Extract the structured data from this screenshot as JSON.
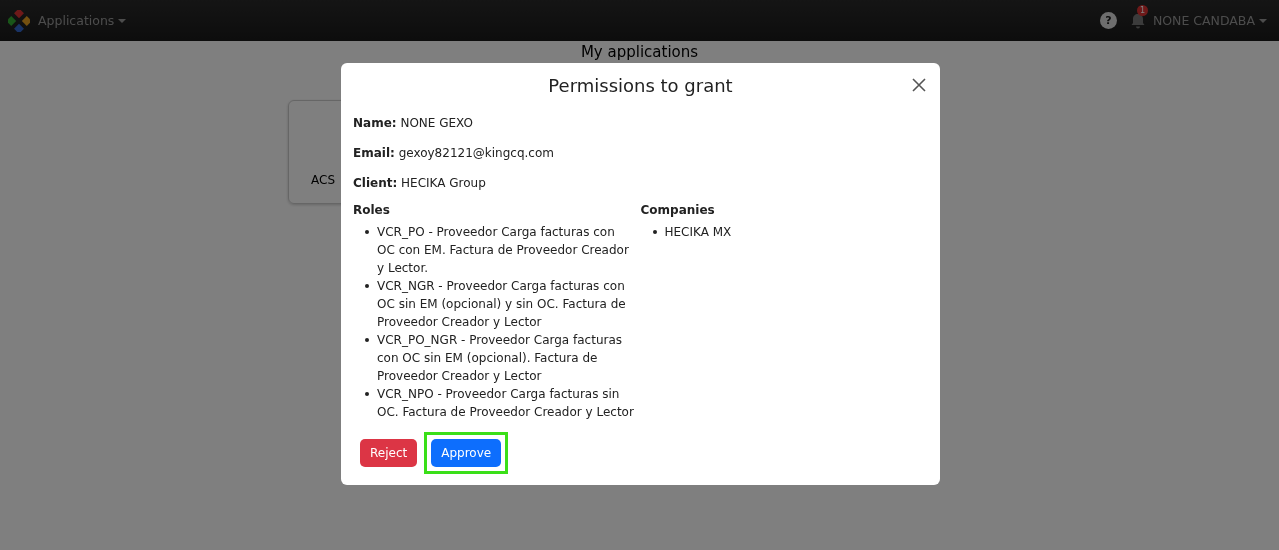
{
  "navbar": {
    "app_menu": "Applications",
    "help": "?",
    "notifications": {
      "count": "1"
    },
    "user_menu": "NONE CANDABA"
  },
  "page": {
    "title": "My applications",
    "cards": [
      {
        "label": "ACS"
      }
    ]
  },
  "modal": {
    "title": "Permissions to grant",
    "fields": [
      {
        "label": "Name:",
        "value": "NONE GEXO"
      },
      {
        "label": "Email:",
        "value": "gexoy82121@kingcq.com"
      },
      {
        "label": "Client:",
        "value": "HECIKA Group"
      }
    ],
    "roles": {
      "heading": "Roles",
      "items": [
        "VCR_PO - Proveedor Carga facturas con OC con EM. Factura de Proveedor Creador y Lector.",
        "VCR_NGR - Proveedor Carga facturas con OC sin EM (opcional) y sin OC. Factura de Proveedor Creador y Lector",
        "VCR_PO_NGR - Proveedor Carga facturas con OC sin EM (opcional). Factura de Proveedor Creador y Lector",
        "VCR_NPO - Proveedor Carga facturas sin OC. Factura de Proveedor Creador y Lector"
      ]
    },
    "companies": {
      "heading": "Companies",
      "items": [
        "HECIKA MX"
      ]
    },
    "buttons": [
      {
        "label": "Reject",
        "kind": "danger",
        "highlighted": false
      },
      {
        "label": "Approve",
        "kind": "primary",
        "highlighted": true
      }
    ]
  }
}
